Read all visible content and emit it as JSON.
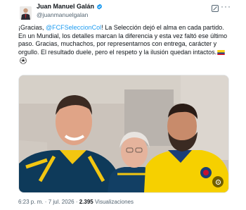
{
  "author": {
    "display_name": "Juan Manuel Galán",
    "handle": "@juanmanuelgalan",
    "verified_icon": "verified-badge-icon"
  },
  "actions": {
    "grok_icon": "grok-icon",
    "more_label": "···"
  },
  "post": {
    "line1_pre": "¡Gracias, ",
    "mention": "@FCFSeleccionCol",
    "line1_post": "! La Selección dejó el alma en cada partido.",
    "line2": "En un Mundial, los detalles marcan la diferencia y esta vez faltó ese último paso. Gracias, muchachos, por representarnos con entrega, carácter y orgullo. El resultado duele, pero el respeto y la ilusión quedan intactos.",
    "emoji": [
      "colombia-flag-icon",
      "soccer-ball-icon"
    ]
  },
  "media": {
    "type": "photo",
    "overlay_icon": "photo-menu-icon"
  },
  "footer": {
    "time": "6:23 p. m.",
    "sep1": " · ",
    "date": "7 jul. 2026",
    "sep2": " · ",
    "views_count": "2.395",
    "views_label": " Visualizaciones"
  }
}
